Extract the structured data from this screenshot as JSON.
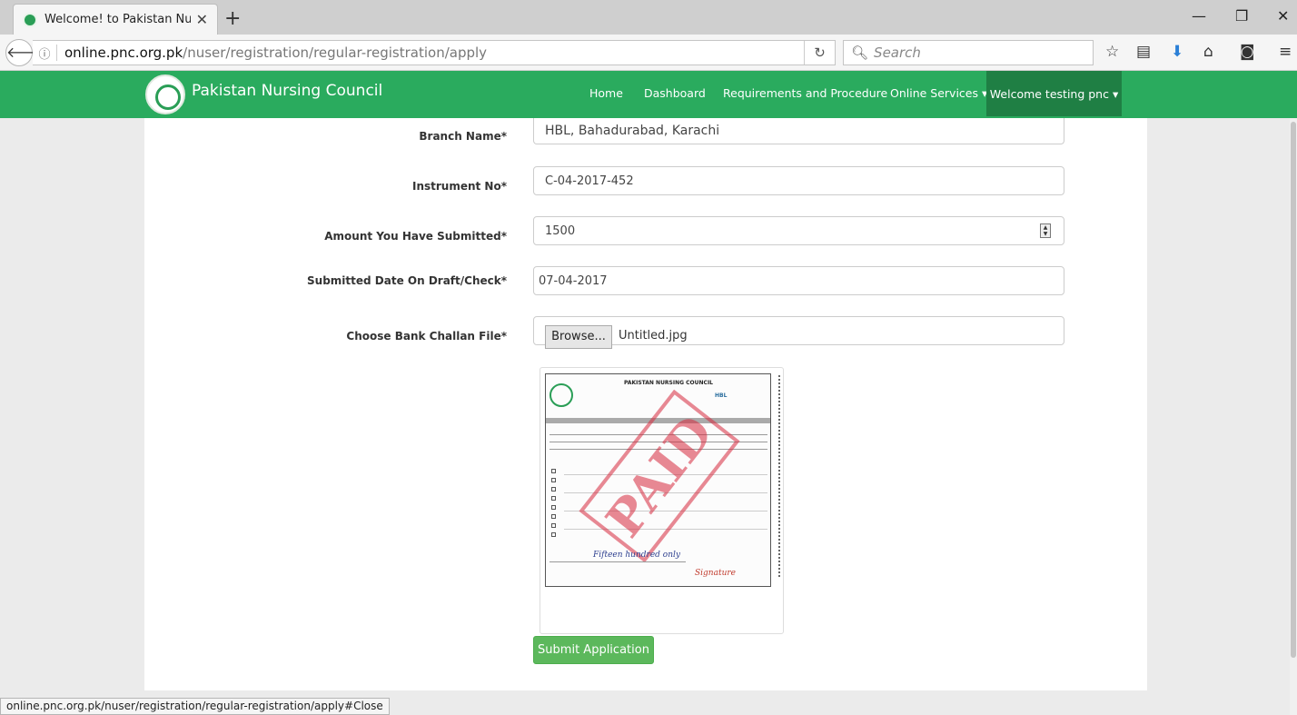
{
  "browser": {
    "tab_title": "Welcome! to Pakistan Nur...",
    "url_host": "online.pnc.org.pk",
    "url_path": "/nuser/registration/regular-registration/apply",
    "search_placeholder": "Search",
    "status_url": "online.pnc.org.pk/nuser/registration/regular-registration/apply#Close"
  },
  "header": {
    "site_name": "Pakistan Nursing Council",
    "nav": [
      "Home",
      "Dashboard",
      "Requirements and Procedure",
      "Online Services ▾"
    ],
    "welcome": "Welcome testing pnc ▾"
  },
  "form": {
    "branch_label": "Branch Name*",
    "branch_value": "HBL, Bahadurabad,  Karachi",
    "instrument_label": "Instrument No*",
    "instrument_value": "C-04-2017-452",
    "amount_label": "Amount You Have Submitted*",
    "amount_value": "1500",
    "date_label": "Submitted Date On Draft/Check*",
    "date_value": "07-04-2017",
    "file_label": "Choose Bank Challan File*",
    "browse_label": "Browse...",
    "file_name": "Untitled.jpg",
    "submit_label": "Submit Application"
  },
  "preview": {
    "doc_title": "PAKISTAN NURSING COUNCIL",
    "bank": "HBL",
    "stamp": "PAID",
    "amount_words": "Fifteen hundred only",
    "signature": "Signature"
  }
}
